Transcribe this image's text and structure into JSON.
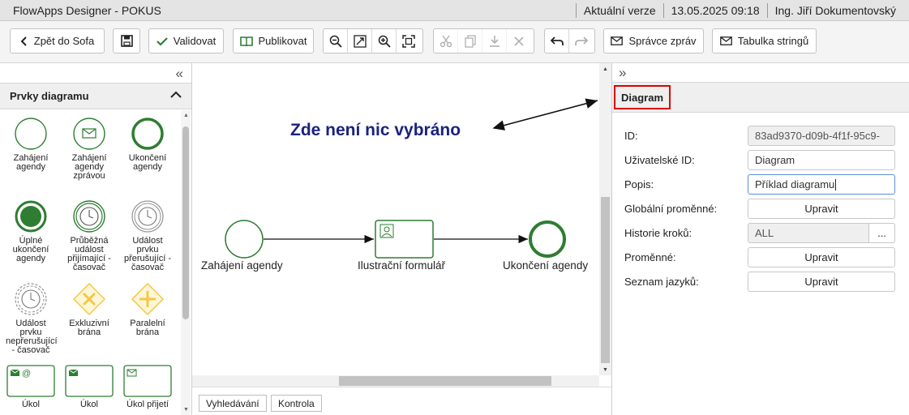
{
  "titlebar": {
    "app_title": "FlowApps Designer - POKUS",
    "version": "Aktuální verze",
    "datetime": "13.05.2025 09:18",
    "user": "Ing. Jiří Dokumentovský"
  },
  "toolbar": {
    "back_label": "Zpět do Sofa",
    "validate_label": "Validovat",
    "publish_label": "Publikovat",
    "messages_label": "Správce zpráv",
    "strings_label": "Tabulka stringů",
    "icons": [
      "back-icon",
      "save-icon",
      "check-icon",
      "book-icon",
      "zoom-out-icon",
      "zoom-fit-icon",
      "zoom-in-icon",
      "fit-screen-icon",
      "cut-icon",
      "copy-icon",
      "paste-icon",
      "delete-icon",
      "undo-icon",
      "redo-icon",
      "envelope-icon"
    ]
  },
  "left_panel": {
    "title": "Prvky diagramu",
    "items": [
      {
        "label": "Zahájení agendy"
      },
      {
        "label": "Zahájení agendy zprávou"
      },
      {
        "label": "Ukončení agendy"
      },
      {
        "label": "Úplné ukončení agendy"
      },
      {
        "label": "Průběžná událost přijímající - časovač"
      },
      {
        "label": "Událost prvku přerušující - časovač"
      },
      {
        "label": "Událost prvku nepřerušující - časovač"
      },
      {
        "label": "Exkluzivní brána"
      },
      {
        "label": "Paralelní brána"
      },
      {
        "label": "Úkol"
      },
      {
        "label": "Úkol"
      },
      {
        "label": "Úkol přijetí"
      }
    ]
  },
  "canvas": {
    "annotation": "Zde není nic vybráno",
    "nodes": {
      "start": "Zahájení agendy",
      "task": "Ilustrační formulář",
      "end": "Ukončení agendy"
    },
    "tabs": [
      "Vyhledávání",
      "Kontrola"
    ]
  },
  "right_panel": {
    "title": "Diagram",
    "props": {
      "id_label": "ID:",
      "id_value": "83ad9370-d09b-4f1f-95c9-",
      "user_id_label": "Uživatelské ID:",
      "user_id_value": "Diagram",
      "desc_label": "Popis:",
      "desc_value": "Příklad diagramu",
      "globals_label": "Globální proměnné:",
      "globals_button": "Upravit",
      "history_label": "Historie kroků:",
      "history_value": "ALL",
      "history_button": "...",
      "vars_label": "Proměnné:",
      "vars_button": "Upravit",
      "langs_label": "Seznam jazyků:",
      "langs_button": "Upravit"
    }
  },
  "colors": {
    "bpmn_green": "#2e7d32",
    "annotation_blue": "#1a237e",
    "gateway_yellow": "#f5c842",
    "highlight_red": "#e00000"
  }
}
